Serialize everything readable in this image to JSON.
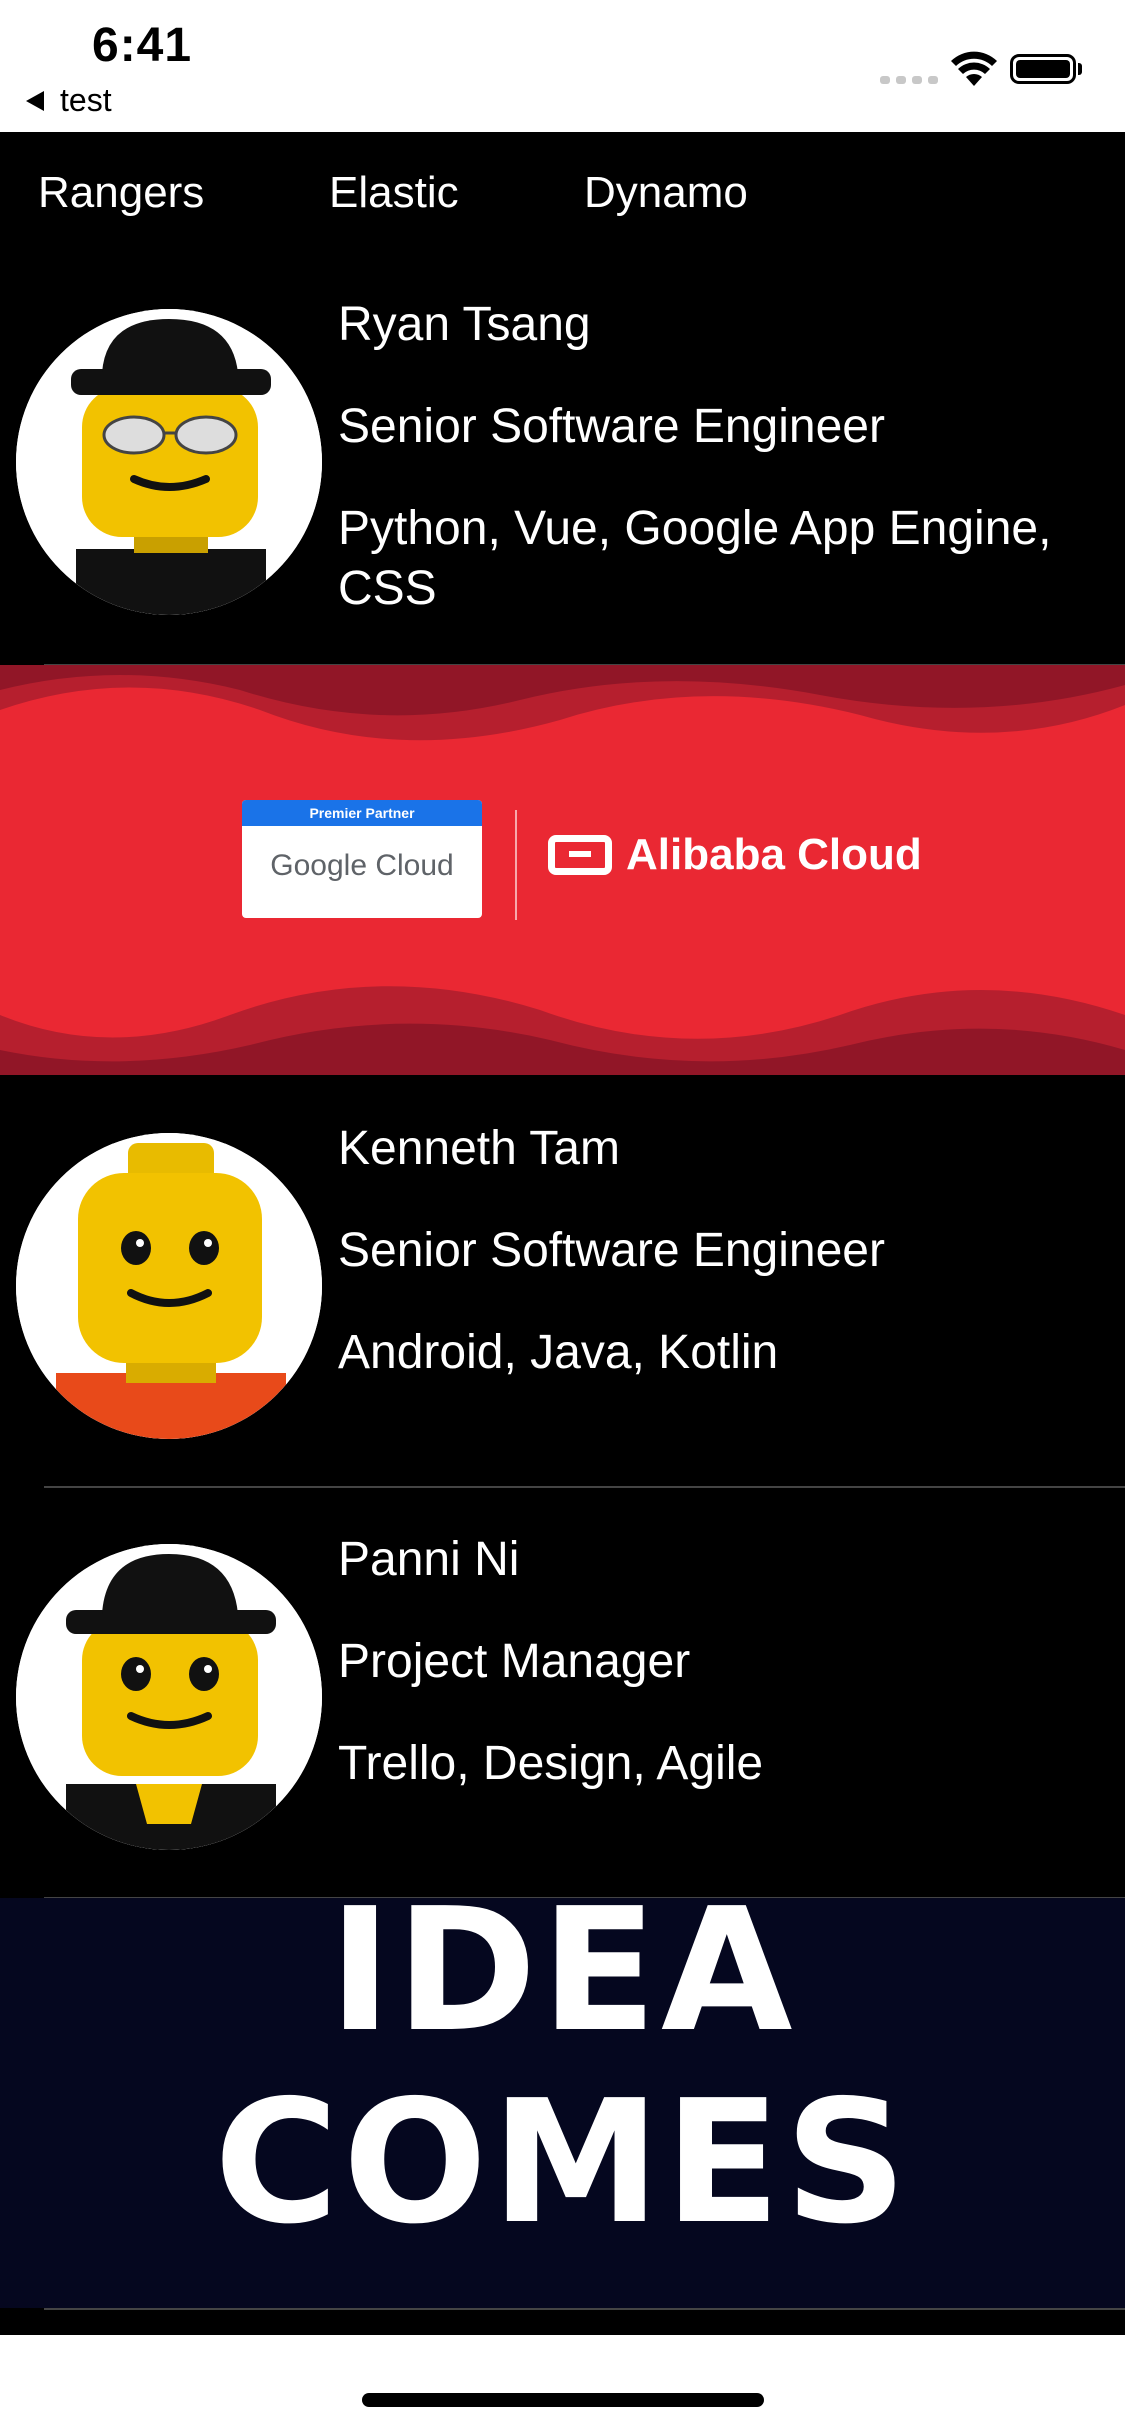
{
  "status_bar": {
    "time": "6:41",
    "back_label": "test"
  },
  "tabs": [
    {
      "label": "Rangers"
    },
    {
      "label": "Elastic"
    },
    {
      "label": "Dynamo"
    }
  ],
  "people": [
    {
      "name": "Ryan Tsang",
      "title": "Senior Software Engineer",
      "skills": "Python, Vue, Google App Engine, CSS",
      "avatar": "lego-figure-hat-glasses"
    },
    {
      "name": "Kenneth Tam",
      "title": "Senior Software Engineer",
      "skills": "Android, Java, Kotlin",
      "avatar": "lego-figure-plain"
    },
    {
      "name": "Panni Ni",
      "title": "Project Manager",
      "skills": "Trello, Design, Agile",
      "avatar": "lego-figure-hat"
    }
  ],
  "banner_cloud": {
    "partner_label": "Premier Partner",
    "google_cloud": "Google Cloud",
    "alibaba_cloud": "Alibaba Cloud",
    "background": "#ea2833"
  },
  "banner_idea": {
    "line1": "IDEA",
    "line2": "COMES",
    "background": "#05071f"
  }
}
